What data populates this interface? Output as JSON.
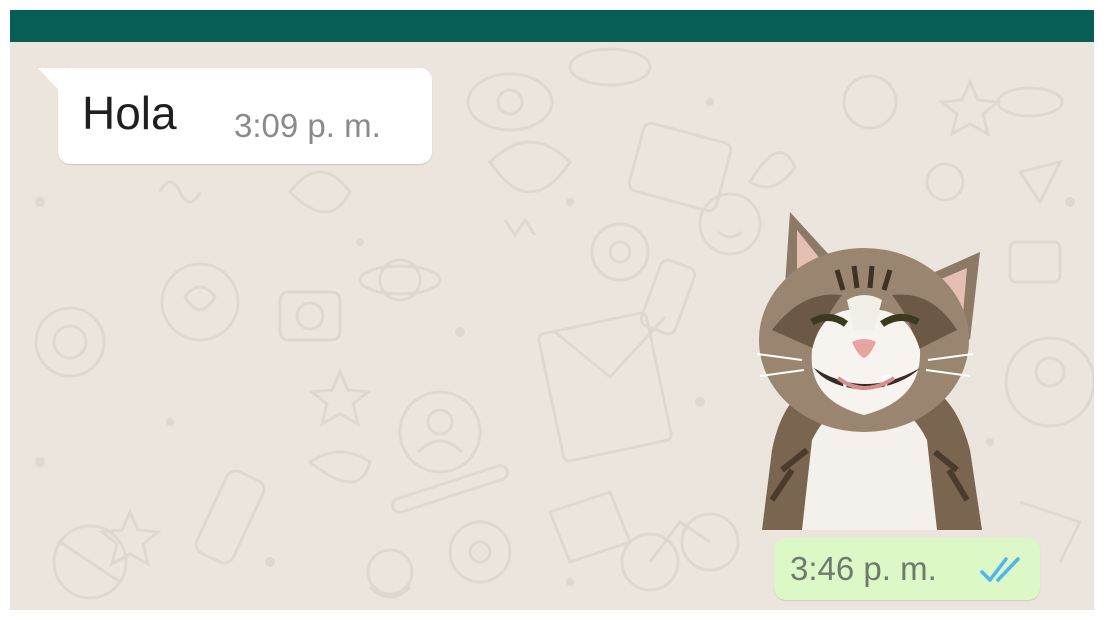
{
  "chat": {
    "incoming_message": {
      "text": "Hola",
      "time": "3:09 p. m."
    },
    "outgoing_sticker": {
      "sticker_icon": "smiling-cat-sticker",
      "time": "3:46 p. m.",
      "status_icon": "double-check-read-icon"
    }
  },
  "colors": {
    "header": "#075e54",
    "wallpaper": "#ece5dd",
    "incoming_bubble": "#ffffff",
    "outgoing_bubble": "#dcf8c6",
    "read_ticks": "#4fb6ec"
  }
}
